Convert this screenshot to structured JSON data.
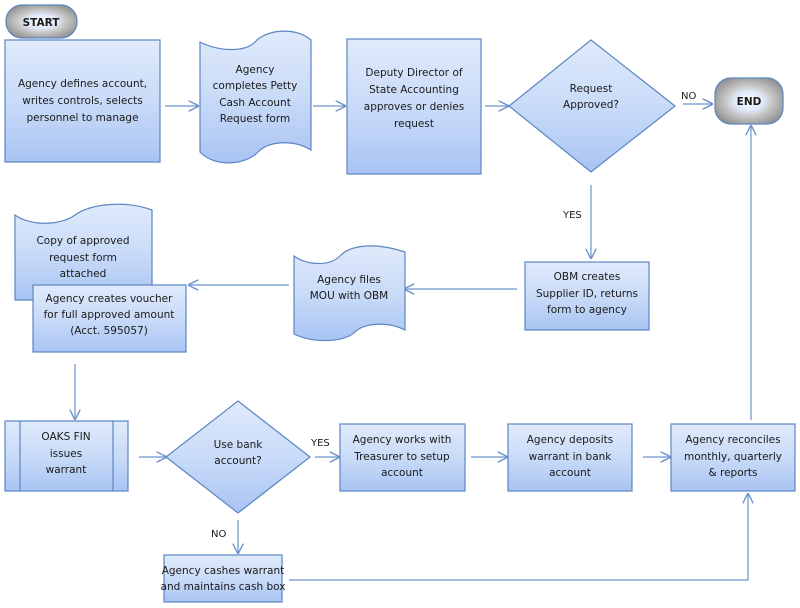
{
  "diagram": {
    "colors": {
      "fill_top": "#dbe7fb",
      "fill_bottom": "#a9c4f3",
      "stroke": "#5b86c3",
      "connector": "#6d93cc",
      "terminator_outer": "#8f8f8f",
      "terminator_inner": "#ffffff"
    },
    "terminators": {
      "start": "START",
      "end": "END"
    },
    "nodes": {
      "define_account": [
        "Agency defines account,",
        "writes controls, selects",
        "personnel to manage"
      ],
      "request_form": [
        "Agency",
        "completes Petty",
        "Cash Account",
        "Request form"
      ],
      "deputy_director": [
        "Deputy Director of",
        "State Accounting",
        "approves or denies",
        "request"
      ],
      "request_approved": [
        "Request",
        "Approved?"
      ],
      "obm_supplier": [
        "OBM creates",
        "Supplier ID, returns",
        "form to agency"
      ],
      "files_mou": [
        "Agency files",
        "MOU with OBM"
      ],
      "copy_form": [
        "Copy of approved",
        "request form",
        "attached"
      ],
      "create_voucher": [
        "Agency creates voucher",
        "for full approved amount",
        "(Acct. 595057)"
      ],
      "oaks_fin": [
        "OAKS FIN",
        "issues",
        "warrant"
      ],
      "use_bank": [
        "Use bank",
        "account?"
      ],
      "treasurer": [
        "Agency works with",
        "Treasurer to setup",
        "account"
      ],
      "deposits": [
        "Agency deposits",
        "warrant in bank",
        "account"
      ],
      "reconciles": [
        "Agency reconciles",
        "monthly, quarterly",
        "& reports"
      ],
      "cash_box": [
        "Agency cashes warrant",
        "and maintains cash box"
      ]
    },
    "edge_labels": {
      "approved_no": "NO",
      "approved_yes": "YES",
      "bank_yes": "YES",
      "bank_no": "NO"
    }
  }
}
